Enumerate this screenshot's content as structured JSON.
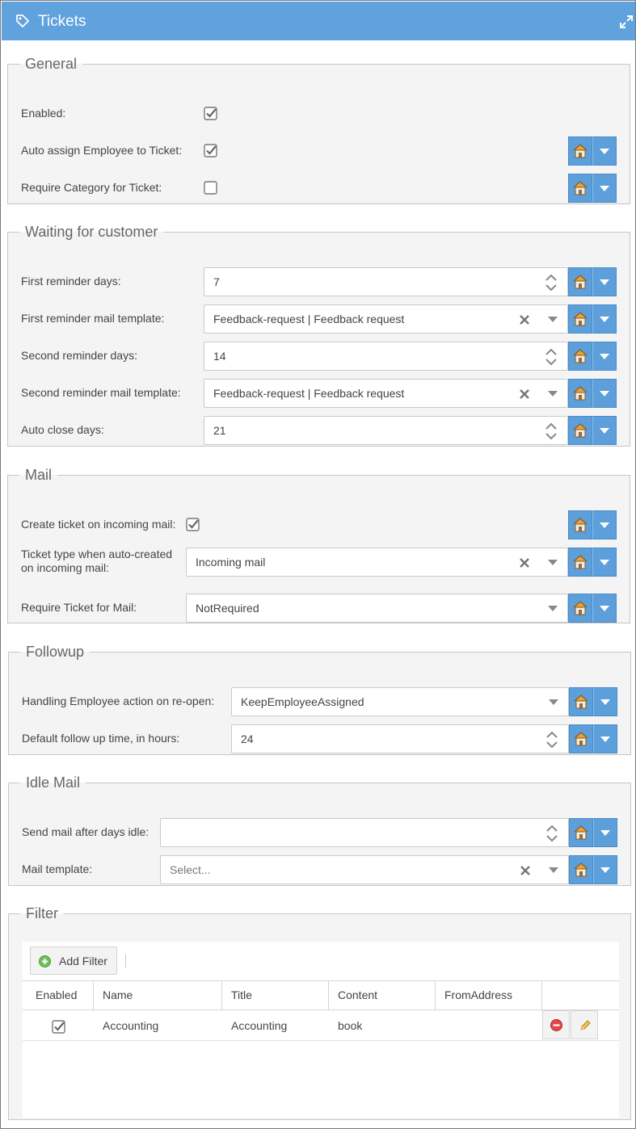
{
  "window": {
    "title": "Tickets",
    "tag_icon": "tag-icon",
    "expand_icon": "expand-icon"
  },
  "colors": {
    "titlebar": "#5fa2dd",
    "button": "#5c9fdb",
    "panel": "#f4f4f4"
  },
  "general": {
    "legend": "General",
    "enabled_label": "Enabled:",
    "enabled_checked": true,
    "auto_assign_label": "Auto assign Employee to Ticket:",
    "auto_assign_checked": true,
    "require_category_label": "Require Category for Ticket:",
    "require_category_checked": false
  },
  "waiting": {
    "legend": "Waiting for customer",
    "first_days_label": "First reminder days:",
    "first_days_value": "7",
    "first_template_label": "First reminder mail template:",
    "first_template_value": "Feedback-request | Feedback request",
    "second_days_label": "Second reminder days:",
    "second_days_value": "14",
    "second_template_label": "Second reminder mail template:",
    "second_template_value": "Feedback-request | Feedback request",
    "auto_close_label": "Auto close days:",
    "auto_close_value": "21"
  },
  "mail": {
    "legend": "Mail",
    "create_label": "Create ticket on incoming mail:",
    "create_checked": true,
    "ticket_type_label": "Ticket type when auto-created on incoming mail:",
    "ticket_type_value": "Incoming mail",
    "require_ticket_label": "Require Ticket for Mail:",
    "require_ticket_value": "NotRequired"
  },
  "followup": {
    "legend": "Followup",
    "handling_label": "Handling Employee action on re-open:",
    "handling_value": "KeepEmployeeAssigned",
    "default_time_label": "Default follow up time, in hours:",
    "default_time_value": "24"
  },
  "idle": {
    "legend": "Idle Mail",
    "send_after_label": "Send mail after days idle:",
    "send_after_value": "",
    "template_label": "Mail template:",
    "template_placeholder": "Select..."
  },
  "filter": {
    "legend": "Filter",
    "add_button": "Add Filter",
    "columns": [
      "Enabled",
      "Name",
      "Title",
      "Content",
      "FromAddress"
    ],
    "rows": [
      {
        "enabled": true,
        "name": "Accounting",
        "title": "Accounting",
        "content": "book",
        "from_address": ""
      }
    ]
  }
}
